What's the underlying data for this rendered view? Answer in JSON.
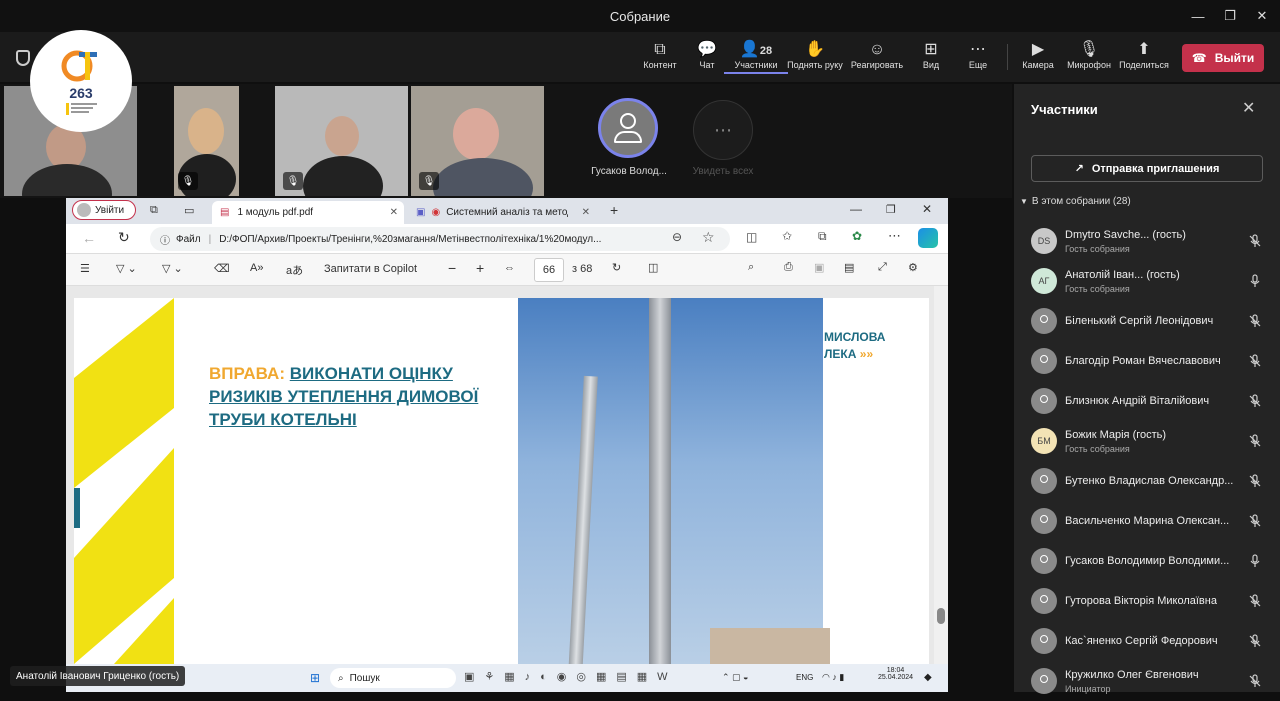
{
  "window": {
    "title": "Собрание"
  },
  "toolbar": {
    "content": "Контент",
    "chat": "Чат",
    "participants": "Участники",
    "participants_count": "28",
    "raise_hand": "Поднять руку",
    "react": "Реагировать",
    "view": "Вид",
    "more": "Еще",
    "camera": "Камера",
    "mic": "Микрофон",
    "share": "Поделиться",
    "leave": "Выйти"
  },
  "logo": {
    "number": "263"
  },
  "video": {
    "tile_name": "Гусаков Волод...",
    "see_all": "Увидеть всех"
  },
  "browser": {
    "profile": "Увійти",
    "tab1": "1 модуль pdf.pdf",
    "tab2": "Системний аналіз та методи",
    "url_label": "Файл",
    "url": "D:/ФОП/Архив/Проекты/Тренінги,%20змагання/Метінвестполітехніка/1%20модул...",
    "copilot": "Запитати в Copilot",
    "page": "66",
    "page_total": "з 68"
  },
  "slide": {
    "lead": "ВПРАВА:",
    "title": "ВИКОНАТИ ОЦІНКУ РИЗИКІВ УТЕПЛЕННЯ ДИМОВОЇ ТРУБИ КОТЕЛЬНІ",
    "brand1": "МИСЛОВА",
    "brand2": "ЛЕКА"
  },
  "taskbar": {
    "search": "Пошук",
    "lang": "ENG",
    "time": "18:04",
    "date": "25.04.2024"
  },
  "caption": "Анатолій Іванович Гриценко (гость)",
  "panel": {
    "title": "Участники",
    "invite": "Отправка приглашения",
    "section": "В этом собрании (28)",
    "people": [
      {
        "initials": "DS",
        "name": "Dmytro Savche... (гость)",
        "role": "Гость собрания",
        "mic": "off",
        "color": "#c8c8c8"
      },
      {
        "initials": "АГ",
        "name": "Анатолій Іван... (гость)",
        "role": "Гость собрания",
        "mic": "on",
        "color": "#cfe8d8"
      },
      {
        "initials": "",
        "name": "Біленький Сергій Леонідович",
        "role": "",
        "mic": "off",
        "color": "#8a8a8a"
      },
      {
        "initials": "",
        "name": "Благодір Роман Вячеславович",
        "role": "",
        "mic": "off",
        "color": "#8a8a8a"
      },
      {
        "initials": "",
        "name": "Близнюк Андрій Віталійович",
        "role": "",
        "mic": "off",
        "color": "#8a8a8a"
      },
      {
        "initials": "БМ",
        "name": "Божик Марія (гость)",
        "role": "Гость собрания",
        "mic": "off",
        "color": "#f3e3b5"
      },
      {
        "initials": "",
        "name": "Бутенко Владислав Олександр...",
        "role": "",
        "mic": "off",
        "color": "#8a8a8a"
      },
      {
        "initials": "",
        "name": "Васильченко Марина Олексан...",
        "role": "",
        "mic": "off",
        "color": "#8a8a8a"
      },
      {
        "initials": "",
        "name": "Гусаков Володимир Володими...",
        "role": "",
        "mic": "on",
        "color": "#8a8a8a"
      },
      {
        "initials": "",
        "name": "Гуторова Вікторія Миколаївна",
        "role": "",
        "mic": "off",
        "color": "#8a8a8a"
      },
      {
        "initials": "",
        "name": "Кас`яненко Сергій Федорович",
        "role": "",
        "mic": "off",
        "color": "#8a8a8a"
      },
      {
        "initials": "",
        "name": "Кружилко Олег Євгенович",
        "role": "Инициатор",
        "mic": "off",
        "color": "#8a8a8a"
      }
    ]
  }
}
